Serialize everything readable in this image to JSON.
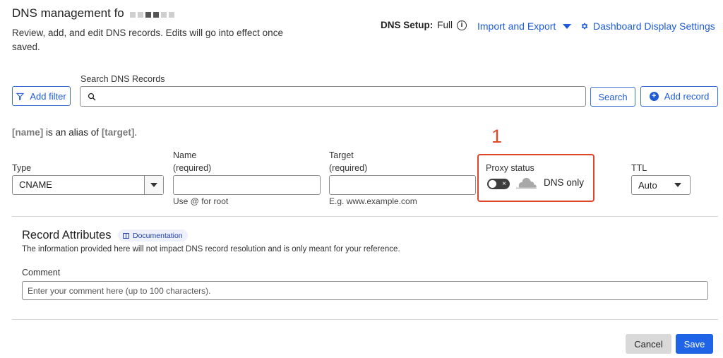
{
  "header": {
    "title": "DNS management fo",
    "subtitle": "Review, add, and edit DNS records. Edits will go into effect once saved.",
    "dns_setup_label": "DNS Setup:",
    "dns_setup_value": "Full",
    "info_glyph": "i",
    "import_export_label": "Import and Export",
    "dashboard_settings_label": "Dashboard Display Settings"
  },
  "search": {
    "label": "Search DNS Records",
    "placeholder": "",
    "add_filter_label": "Add filter",
    "search_button_label": "Search",
    "add_record_label": "Add record"
  },
  "alias_note": {
    "name_token": "[name]",
    "middle_text": " is an alias of ",
    "target_token": "[target]",
    "end_text": "."
  },
  "annotation": {
    "number": "1",
    "color": "#e04a2b"
  },
  "form": {
    "type_label": "Type",
    "type_value": "CNAME",
    "name_label_line1": "Name",
    "name_label_line2": "(required)",
    "name_value": "",
    "name_hint": "Use @ for root",
    "target_label_line1": "Target",
    "target_label_line2": "(required)",
    "target_value": "",
    "target_hint": "E.g. www.example.com",
    "proxy_label": "Proxy status",
    "proxy_toggle_glyph": "×",
    "proxy_state": "DNS only",
    "ttl_label": "TTL",
    "ttl_value": "Auto"
  },
  "record_attributes": {
    "title": "Record Attributes",
    "documentation_label": "Documentation",
    "description": "The information provided here will not impact DNS record resolution and is only meant for your reference.",
    "comment_label": "Comment",
    "comment_placeholder": "Enter your comment here (up to 100 characters)."
  },
  "footer": {
    "cancel_label": "Cancel",
    "save_label": "Save"
  },
  "colors": {
    "accent": "#1e5bd6",
    "primary_button": "#1f63e6",
    "annotation": "#e04a2b"
  },
  "icons": {
    "filter": "filter-icon",
    "search": "search-icon",
    "add": "plus-circle-icon",
    "settings": "gear-icon",
    "cloud": "cloud-icon",
    "book": "book-icon"
  }
}
